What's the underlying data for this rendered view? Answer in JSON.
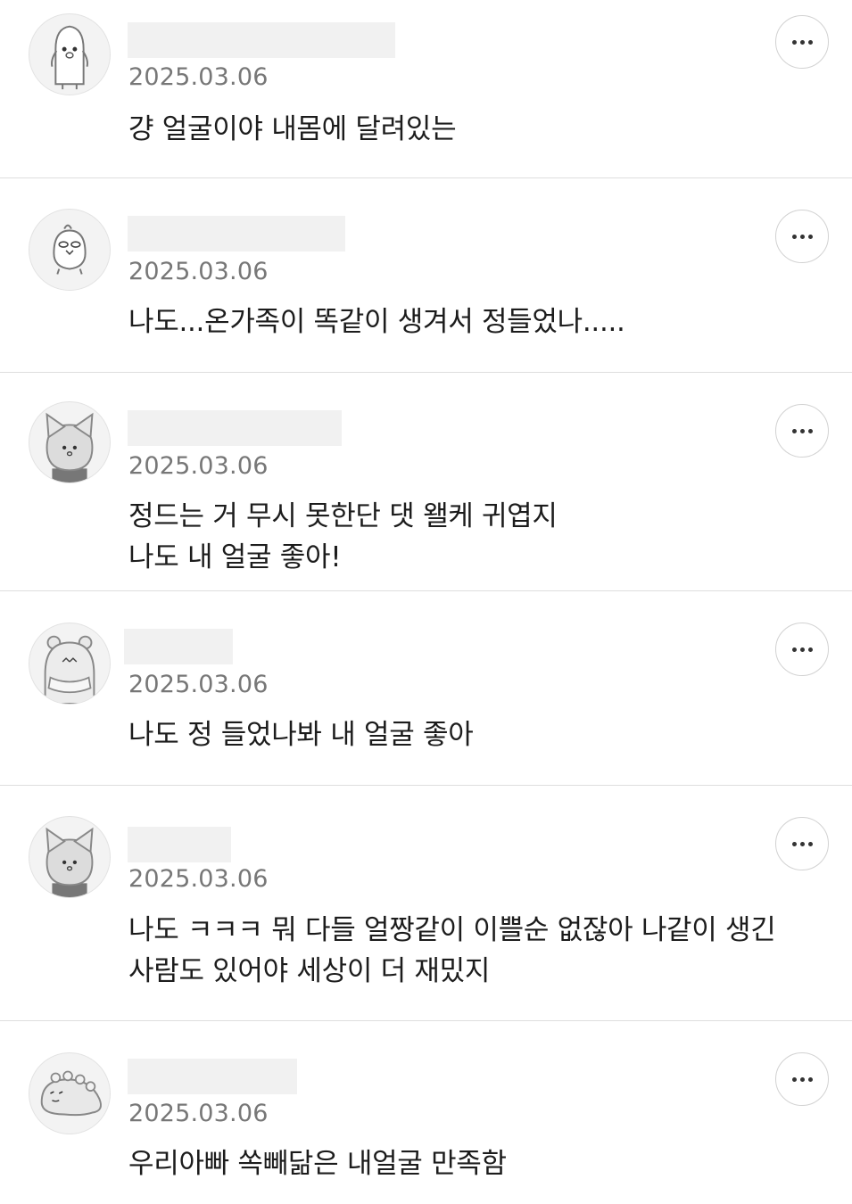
{
  "comments": [
    {
      "avatar_icon": "penguin-avatar-icon",
      "date": "2025.03.06",
      "lines": [
        "걍 얼굴이야 내몸에 달려있는"
      ],
      "more_icon": "more-horizontal-icon"
    },
    {
      "avatar_icon": "chick-avatar-icon",
      "date": "2025.03.06",
      "lines": [
        "나도...온가족이 똑같이 생겨서 정들었나....."
      ],
      "more_icon": "more-horizontal-icon"
    },
    {
      "avatar_icon": "cat-avatar-icon",
      "date": "2025.03.06",
      "lines": [
        "정드는 거 무시 못한단 댓 왤케 귀엽지",
        "나도 내 얼굴 좋아!"
      ],
      "more_icon": "more-horizontal-icon"
    },
    {
      "avatar_icon": "bear-avatar-icon",
      "date": "2025.03.06",
      "lines": [
        "나도 정 들었나봐 내 얼굴 좋아"
      ],
      "more_icon": "more-horizontal-icon"
    },
    {
      "avatar_icon": "cat-avatar-icon",
      "date": "2025.03.06",
      "lines": [
        "나도 ㅋㅋㅋ 뭐 다들 얼짱같이 이쁠순 없잖아 나같이 생긴",
        "사람도 있어야 세상이 더 재밌지"
      ],
      "more_icon": "more-horizontal-icon"
    },
    {
      "avatar_icon": "dinosaur-avatar-icon",
      "date": "2025.03.06",
      "lines": [
        "우리아빠 쏙빼닮은 내얼굴 만족함"
      ],
      "more_icon": "more-horizontal-icon"
    }
  ]
}
